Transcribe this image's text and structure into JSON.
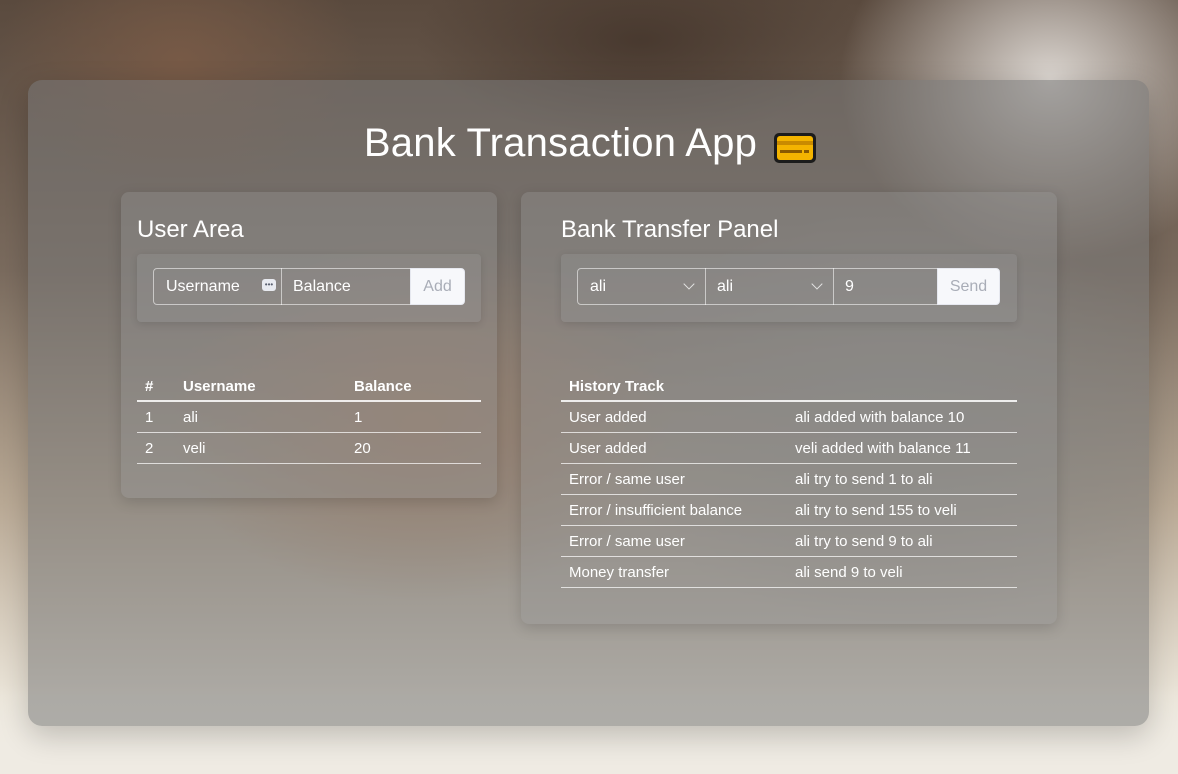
{
  "app": {
    "title": "Bank Transaction App",
    "icon": "credit-card-icon"
  },
  "user_area": {
    "title": "User Area",
    "username_placeholder": "Username",
    "balance_placeholder": "Balance",
    "add_label": "Add",
    "table": {
      "headers": [
        "#",
        "Username",
        "Balance"
      ],
      "rows": [
        [
          "1",
          "ali",
          "1"
        ],
        [
          "2",
          "veli",
          "20"
        ]
      ]
    }
  },
  "transfer_panel": {
    "title": "Bank Transfer Panel",
    "from_selected": "ali",
    "to_selected": "ali",
    "amount_value": "9",
    "send_label": "Send",
    "history": {
      "header": "History Track",
      "rows": [
        [
          "User added",
          "ali added with balance 10"
        ],
        [
          "User added",
          "veli added with balance 11"
        ],
        [
          "Error / same user",
          "ali try to send 1 to ali"
        ],
        [
          "Error / insufficient balance",
          "ali try to send 155 to veli"
        ],
        [
          "Error / same user",
          "ali try to send 9 to ali"
        ],
        [
          "Money transfer",
          "ali send 9 to veli"
        ]
      ]
    }
  }
}
